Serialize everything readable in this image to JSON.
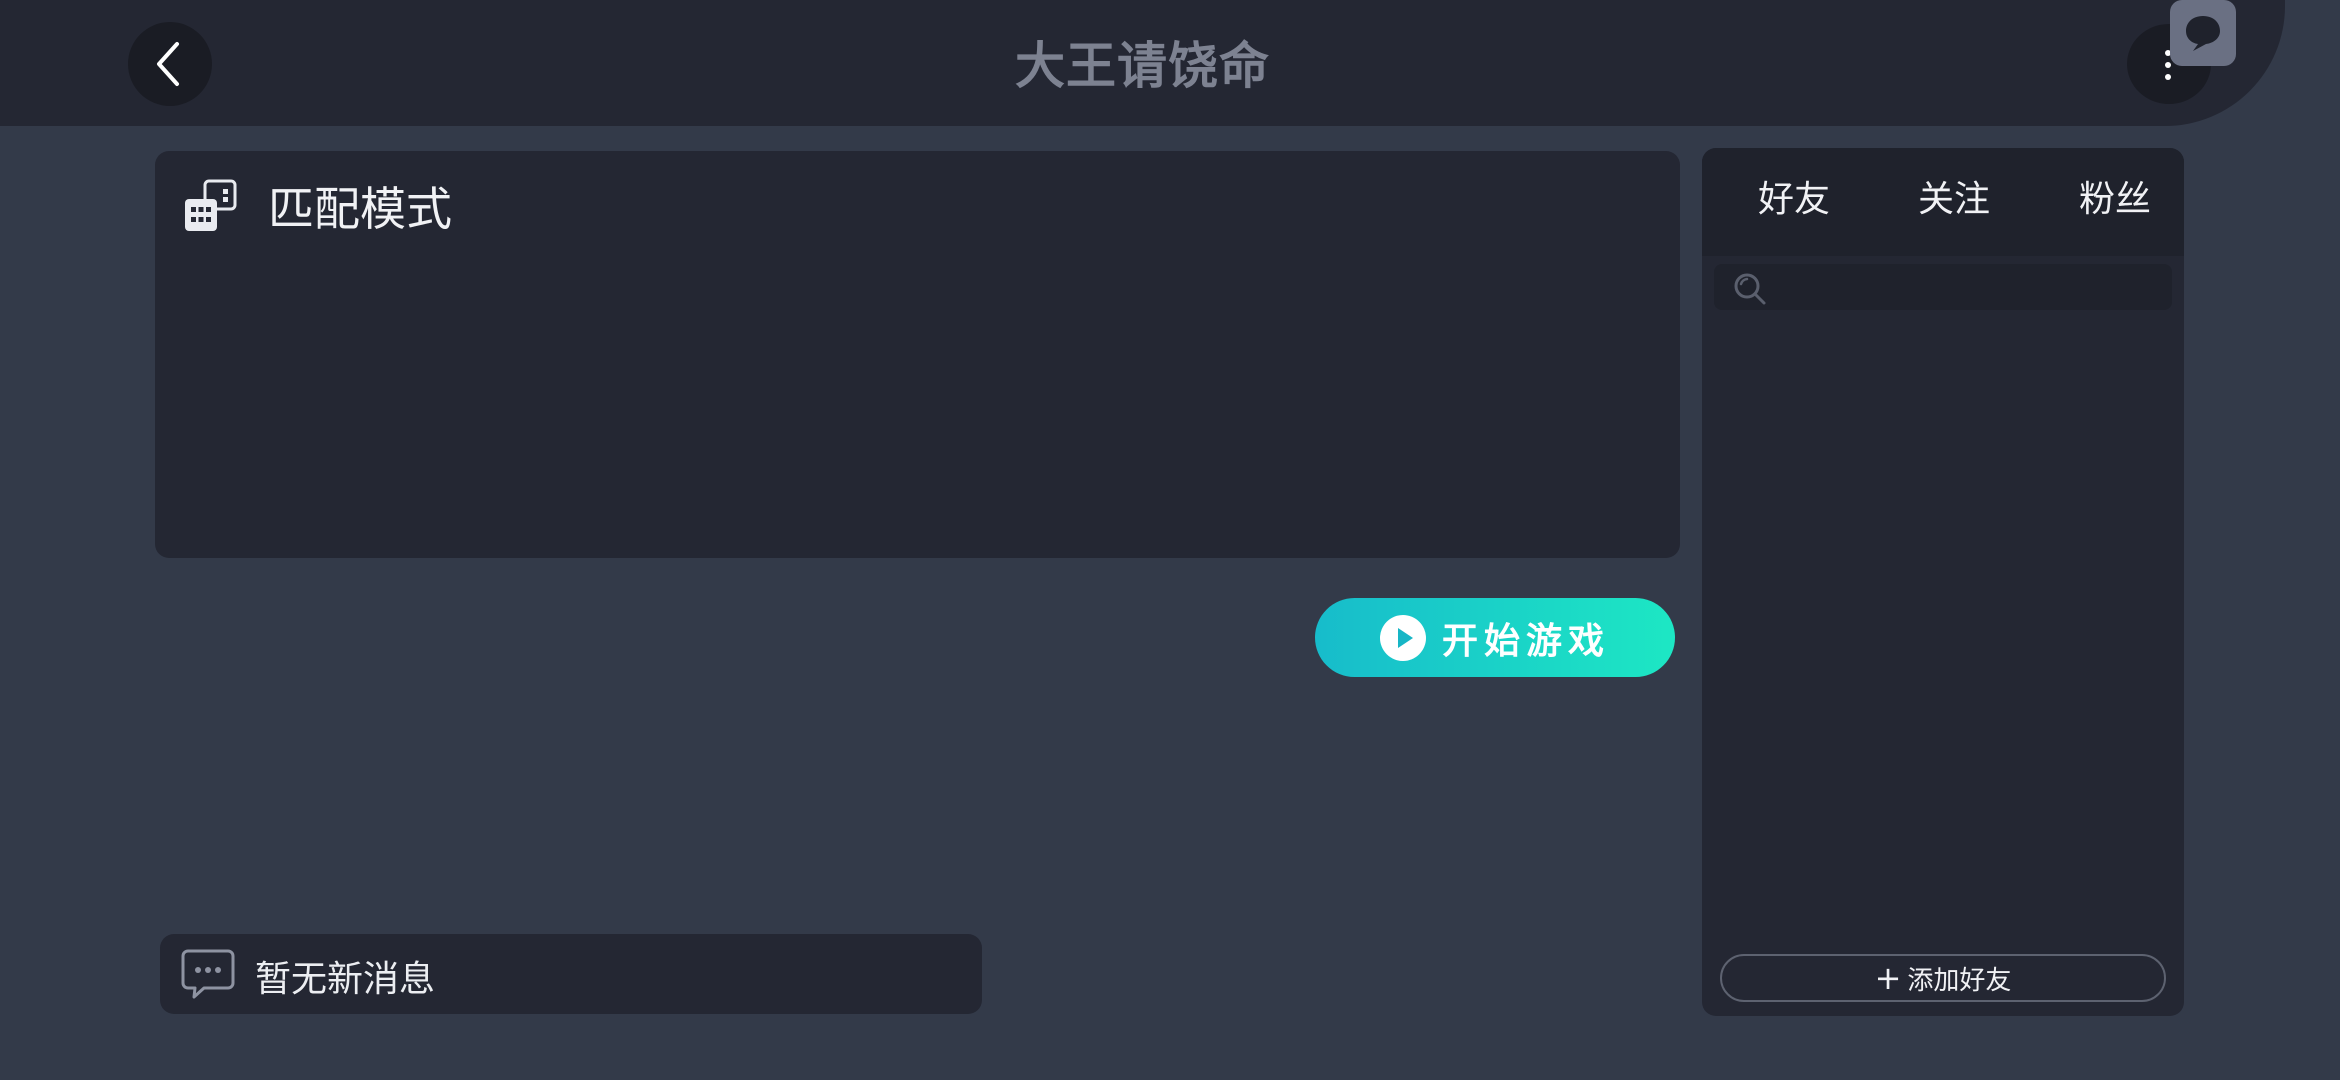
{
  "header": {
    "title": "大王请饶命",
    "back_icon": "chevron-left-icon",
    "more_icon": "more-vertical-icon",
    "chat_icon": "chat-bubble-icon"
  },
  "mode_panel": {
    "title": "匹配模式",
    "icon": "match-mode-icon"
  },
  "start_button": {
    "label": "开始游戏",
    "icon": "play-icon",
    "gradient": [
      "#17bccb",
      "#1de7c4"
    ]
  },
  "message_box": {
    "text": "暂无新消息",
    "icon": "message-icon"
  },
  "social_panel": {
    "tabs": [
      {
        "label": "好友"
      },
      {
        "label": "关注"
      },
      {
        "label": "粉丝"
      }
    ],
    "search": {
      "placeholder": "",
      "icon": "search-icon"
    },
    "add_friend_label": "添加好友",
    "add_friend_icon": "plus-icon"
  },
  "colors": {
    "background": "#333a49",
    "panel": "#242733",
    "accent_start": "#17bccb",
    "accent_end": "#1de7c4"
  }
}
